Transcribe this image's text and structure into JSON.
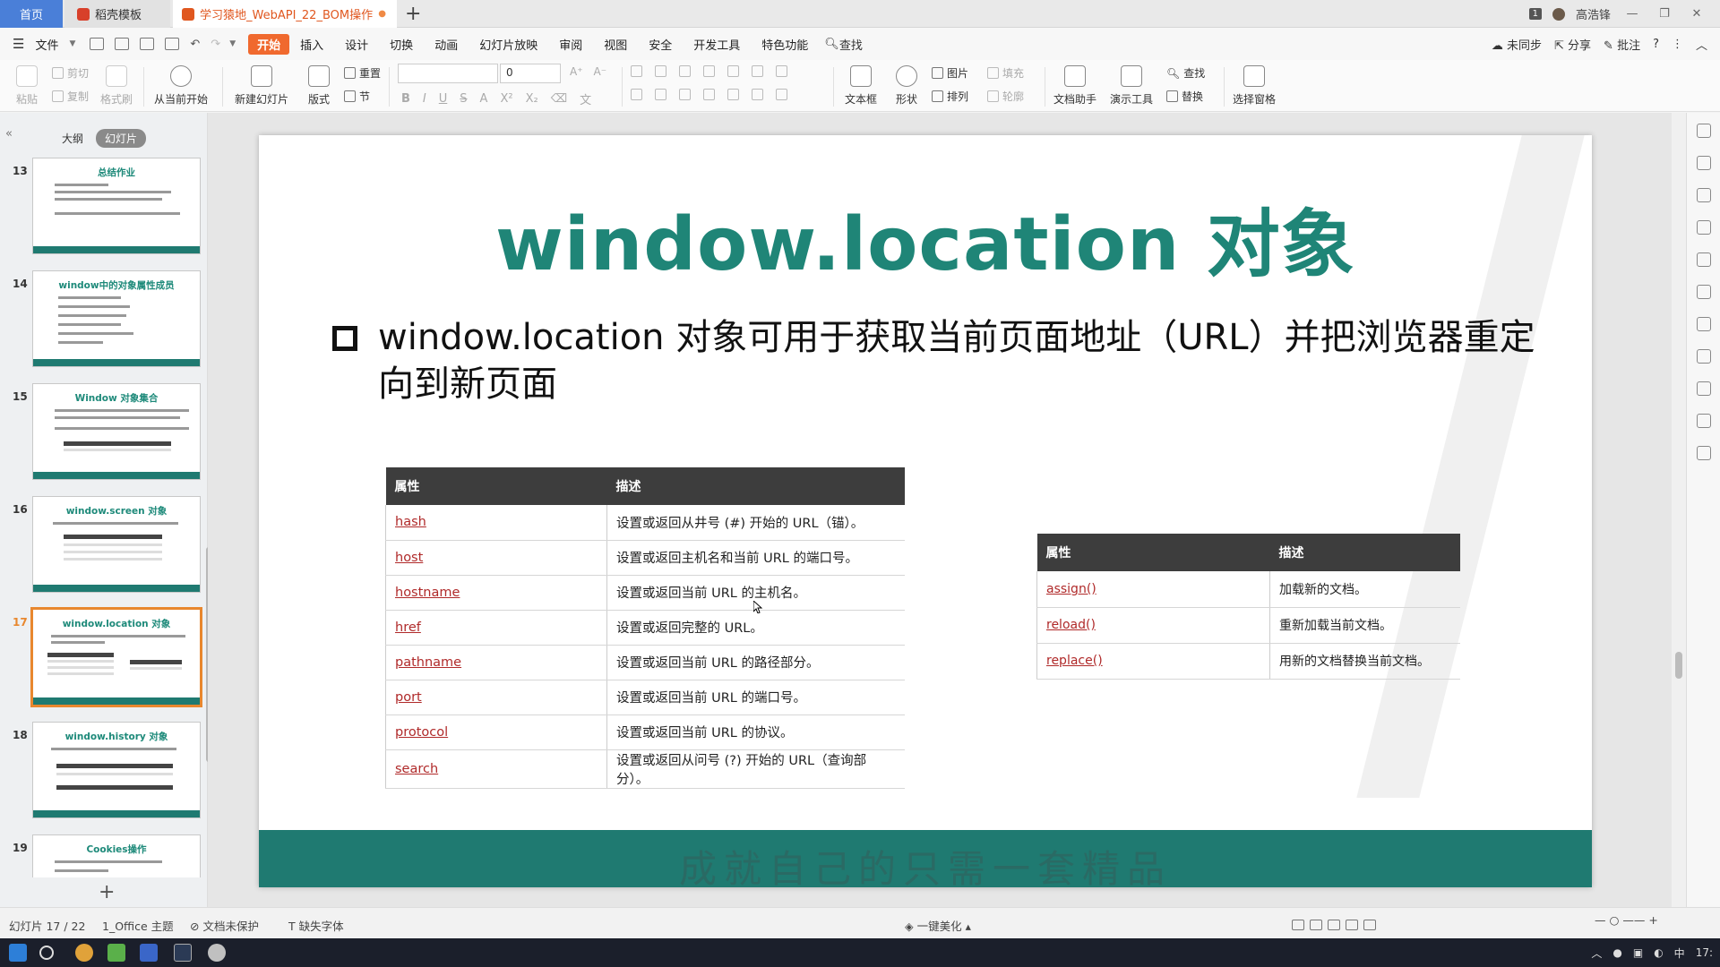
{
  "titlebar": {
    "home_tab": "首页",
    "template_tab": "稻壳模板",
    "doc_tab": "学习猿地_WebAPI_22_BOM操作",
    "badge": "1",
    "user": "高浩锋"
  },
  "menubar": {
    "file": "文件",
    "items": [
      "开始",
      "插入",
      "设计",
      "切换",
      "动画",
      "幻灯片放映",
      "审阅",
      "视图",
      "安全",
      "开发工具",
      "特色功能"
    ],
    "search": "查找",
    "right": [
      "未同步",
      "分享",
      "批注"
    ]
  },
  "ribbon": {
    "paste": "粘贴",
    "cut": "剪切",
    "copy": "复制",
    "format_painter": "格式刷",
    "from_current": "从当前开始",
    "new_slide": "新建幻灯片",
    "layout": "版式",
    "reset": "重置",
    "section": "节",
    "font_size": "0",
    "textbox": "文本框",
    "shape": "形状",
    "picture": "图片",
    "arrange": "排列",
    "fill": "填充",
    "outline": "轮廓",
    "doc_helper": "文档助手",
    "presentation_tools": "演示工具",
    "find": "查找",
    "replace": "替换",
    "selection_pane": "选择窗格"
  },
  "leftpanel": {
    "tab_outline": "大纲",
    "tab_slides": "幻灯片",
    "thumbs": [
      {
        "num": "13",
        "title": "总结作业"
      },
      {
        "num": "14",
        "title": "window中的对象属性成员"
      },
      {
        "num": "15",
        "title": "Window 对象集合"
      },
      {
        "num": "16",
        "title": "window.screen 对象"
      },
      {
        "num": "17",
        "title": "window.location 对象"
      },
      {
        "num": "18",
        "title": "window.history 对象"
      },
      {
        "num": "19",
        "title": "Cookies操作"
      }
    ]
  },
  "slide": {
    "title": "window.location 对象",
    "bullet": "window.location 对象可用于获取当前页面地址（URL）并把浏览器重定向到新页面",
    "table1": {
      "headers": [
        "属性",
        "描述"
      ],
      "rows": [
        [
          "hash",
          "设置或返回从井号 (#) 开始的 URL（锚）。"
        ],
        [
          "host",
          "设置或返回主机名和当前 URL 的端口号。"
        ],
        [
          "hostname",
          "设置或返回当前 URL 的主机名。"
        ],
        [
          "href",
          "设置或返回完整的 URL。"
        ],
        [
          "pathname",
          "设置或返回当前 URL 的路径部分。"
        ],
        [
          "port",
          "设置或返回当前 URL 的端口号。"
        ],
        [
          "protocol",
          "设置或返回当前 URL 的协议。"
        ],
        [
          "search",
          "设置或返回从问号 (?) 开始的 URL（查询部分）。"
        ]
      ]
    },
    "table2": {
      "headers": [
        "属性",
        "描述"
      ],
      "rows": [
        [
          "assign()",
          "加载新的文档。"
        ],
        [
          "reload()",
          "重新加载当前文档。"
        ],
        [
          "replace()",
          "用新的文档替换当前文档。"
        ]
      ]
    },
    "footer": "成就自己的只需一套精品"
  },
  "statusbar": {
    "slide_count": "幻灯片 17 / 22",
    "theme": "1_Office 主题",
    "protect": "文档未保护",
    "missing_font": "缺失字体",
    "beautify": "一键美化"
  },
  "taskbar": {
    "ime": "中",
    "time": "17:"
  },
  "colors": {
    "accent_orange": "#f0692e",
    "slide_teal": "#1f8577",
    "footer_teal": "#1f7a71",
    "link_red": "#b02a2a"
  }
}
